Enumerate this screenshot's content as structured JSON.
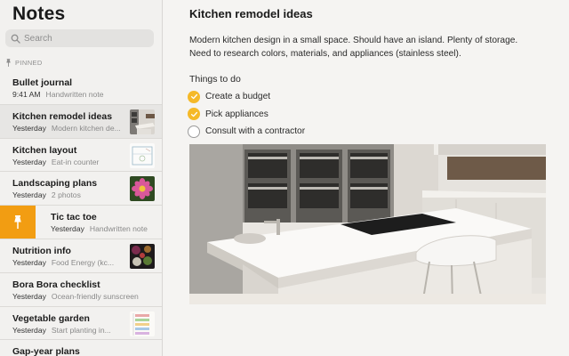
{
  "app": {
    "title": "Notes"
  },
  "search": {
    "placeholder": "Search"
  },
  "sidebar": {
    "pinned_label": "PINNED",
    "notes": [
      {
        "title": "Bullet journal",
        "date": "9:41 AM",
        "preview": "Handwritten note"
      },
      {
        "title": "Kitchen remodel ideas",
        "date": "Yesterday",
        "preview": "Modern kitchen de..."
      },
      {
        "title": "Kitchen layout",
        "date": "Yesterday",
        "preview": "Eat-in counter"
      },
      {
        "title": "Landscaping plans",
        "date": "Yesterday",
        "preview": "2 photos"
      },
      {
        "title": "Tic tac toe",
        "date": "Yesterday",
        "preview": "Handwritten note"
      },
      {
        "title": "Nutrition info",
        "date": "Yesterday",
        "preview": "Food Energy (kc..."
      },
      {
        "title": "Bora Bora checklist",
        "date": "Yesterday",
        "preview": "Ocean-friendly sunscreen"
      },
      {
        "title": "Vegetable garden",
        "date": "Yesterday",
        "preview": "Start planting in..."
      },
      {
        "title": "Gap-year plans",
        "date": "",
        "preview": ""
      }
    ]
  },
  "note": {
    "title": "Kitchen remodel ideas",
    "body_line1": "Modern kitchen design in a small space. Should have an island. Plenty of storage.",
    "body_line2": "Need to research colors, materials, and appliances (stainless steel).",
    "todo_heading": "Things to do",
    "checklist": [
      {
        "label": "Create a budget",
        "checked": true
      },
      {
        "label": "Pick appliances",
        "checked": true
      },
      {
        "label": "Consult with a contractor",
        "checked": false
      }
    ]
  },
  "colors": {
    "accent": "#f5b928",
    "swipe_action": "#f29d12"
  },
  "icons": {
    "search": "search-icon",
    "pin": "pin-icon",
    "check": "checkmark-icon"
  }
}
